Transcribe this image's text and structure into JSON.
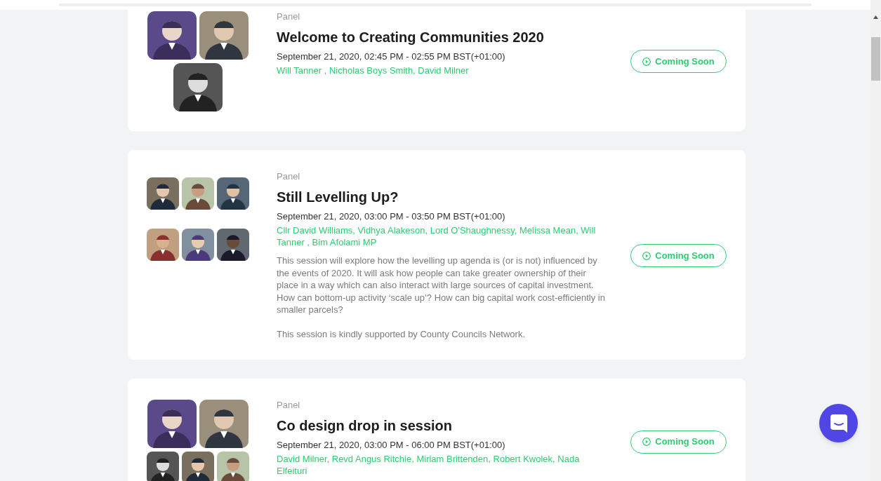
{
  "sessions": [
    {
      "category": "Panel",
      "title": "Welcome to Creating Communities 2020",
      "time": "September 21, 2020, 02:45 PM - 02:55 PM BST(+01:00)",
      "speakers": "Will Tanner , Nicholas Boys Smith, David Milner",
      "avatar_rows": [
        [
          {
            "kind": "picture"
          },
          {
            "kind": "picture"
          }
        ],
        [
          {
            "kind": "picture"
          }
        ]
      ],
      "button": "Coming Soon"
    },
    {
      "category": "Panel",
      "title": "Still Levelling Up?",
      "time": "September 21, 2020, 03:00 PM - 03:50 PM BST(+01:00)",
      "speakers": "Cllr David Williams, Vidhya Alakeson, Lord O'Shaughnessy, Melissa Mean, Will Tanner , Bim Afolami MP",
      "description": [
        "This session will explore how the levelling up agenda is (or is not) influenced by the events of 2020. It will ask how people can take greater ownership of their place in a way which can also interact with large sources of capital investment. How can bottom-up activity ‘scale up’? How can big capital work cost-efficiently in smaller parcels?",
        "This session is kindly supported by County Councils Network."
      ],
      "avatar_rows": [
        [
          {
            "kind": "picture"
          },
          {
            "kind": "picture"
          },
          {
            "kind": "picture"
          }
        ],
        [
          {
            "kind": "picture"
          },
          {
            "kind": "picture"
          },
          {
            "kind": "picture"
          }
        ]
      ],
      "button": "Coming Soon"
    },
    {
      "category": "Panel",
      "title": "Co design drop in session",
      "time": "September 21, 2020, 03:00 PM - 06:00 PM BST(+01:00)",
      "speakers": "David Milner, Revd Angus Ritchie, Miriam Brittenden, Robert Kwolek, Nada Elfeituri",
      "avatar_rows": [
        [
          {
            "kind": "picture"
          },
          {
            "kind": "picture"
          }
        ],
        [
          {
            "kind": "picture"
          },
          {
            "kind": "picture"
          },
          {
            "kind": "picture"
          }
        ]
      ],
      "button": "Coming Soon"
    }
  ]
}
